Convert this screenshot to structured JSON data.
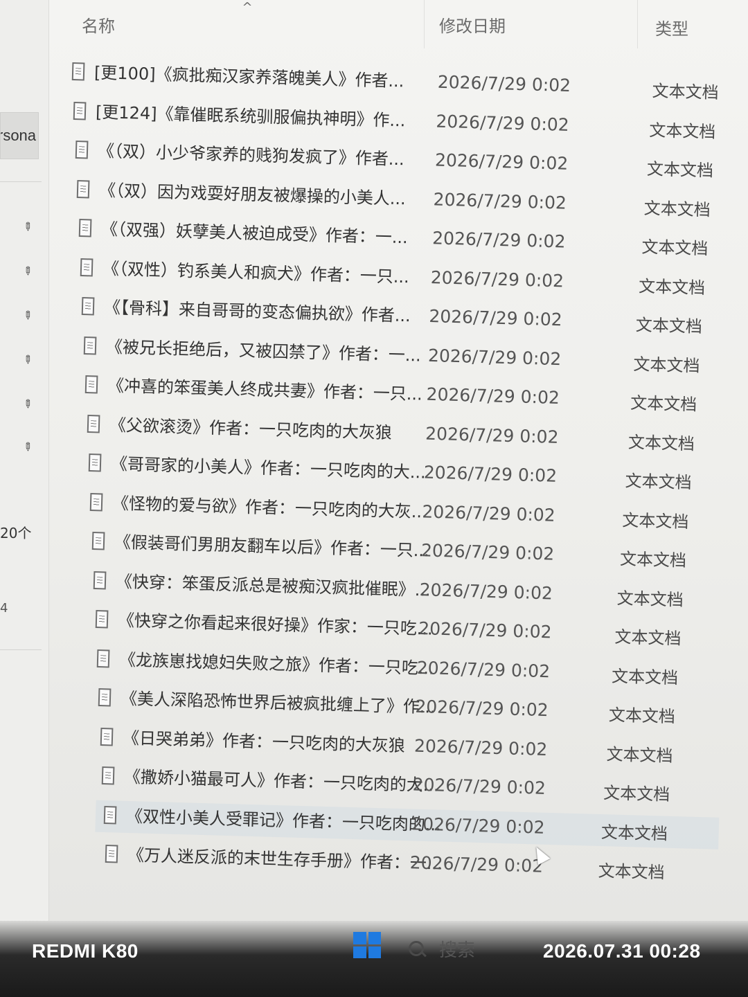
{
  "explorer": {
    "nav": {
      "quick_access_label": "rsona",
      "items_count": "20个",
      "stray_mark": "4"
    },
    "columns": {
      "name": "名称",
      "modified": "修改日期",
      "type": "类型",
      "sort_indicator": "^"
    },
    "files": [
      {
        "name": "[更100]《疯批痴汉家养落魄美人》作者...",
        "date": "2026/7/29 0:02",
        "type": "文本文档"
      },
      {
        "name": "[更124]《靠催眠系统驯服偏执神明》作...",
        "date": "2026/7/29 0:02",
        "type": "文本文档"
      },
      {
        "name": "《（双）小少爷家养的贱狗发疯了》作者...",
        "date": "2026/7/29 0:02",
        "type": "文本文档"
      },
      {
        "name": "《（双）因为戏耍好朋友被爆操的小美人...",
        "date": "2026/7/29 0:02",
        "type": "文本文档"
      },
      {
        "name": "《（双强）妖孽美人被迫成受》作者：一...",
        "date": "2026/7/29 0:02",
        "type": "文本文档"
      },
      {
        "name": "《（双性）钓系美人和疯犬》作者：一只...",
        "date": "2026/7/29 0:02",
        "type": "文本文档"
      },
      {
        "name": "《【骨科】来自哥哥的变态偏执欲》作者...",
        "date": "2026/7/29 0:02",
        "type": "文本文档"
      },
      {
        "name": "《被兄长拒绝后，又被囚禁了》作者：一...",
        "date": "2026/7/29 0:02",
        "type": "文本文档"
      },
      {
        "name": "《冲喜的笨蛋美人终成共妻》作者：一只...",
        "date": "2026/7/29 0:02",
        "type": "文本文档"
      },
      {
        "name": "《父欲滚烫》作者：一只吃肉的大灰狼",
        "date": "2026/7/29 0:02",
        "type": "文本文档"
      },
      {
        "name": "《哥哥家的小美人》作者：一只吃肉的大...",
        "date": "2026/7/29 0:02",
        "type": "文本文档"
      },
      {
        "name": "《怪物的爱与欲》作者：一只吃肉的大灰...",
        "date": "2026/7/29 0:02",
        "type": "文本文档"
      },
      {
        "name": "《假装哥们男朋友翻车以后》作者：一只...",
        "date": "2026/7/29 0:02",
        "type": "文本文档"
      },
      {
        "name": "《快穿：笨蛋反派总是被痴汉疯批催眠》...",
        "date": "2026/7/29 0:02",
        "type": "文本文档"
      },
      {
        "name": "《快穿之你看起来很好操》作家：一只吃...",
        "date": "2026/7/29 0:02",
        "type": "文本文档"
      },
      {
        "name": "《龙族崽找媳妇失败之旅》作者：一只吃...",
        "date": "2026/7/29 0:02",
        "type": "文本文档"
      },
      {
        "name": "《美人深陷恐怖世界后被疯批缠上了》作...",
        "date": "2026/7/29 0:02",
        "type": "文本文档"
      },
      {
        "name": "《日哭弟弟》作者：一只吃肉的大灰狼",
        "date": "2026/7/29 0:02",
        "type": "文本文档"
      },
      {
        "name": "《撒娇小猫最可人》作者：一只吃肉的大...",
        "date": "2026/7/29 0:02",
        "type": "文本文档"
      },
      {
        "name": "《双性小美人受罪记》作者：一只吃肉的...",
        "date": "2026/7/29 0:02",
        "type": "文本文档",
        "selected": true
      },
      {
        "name": "《万人迷反派的末世生存手册》作者：一...",
        "date": "2026/7/29 0:02",
        "type": "文本文档"
      }
    ]
  },
  "taskbar": {
    "search_label": "搜索"
  },
  "watermark": {
    "device": "REDMI K80",
    "timestamp": "2026.07.31 00:28"
  }
}
